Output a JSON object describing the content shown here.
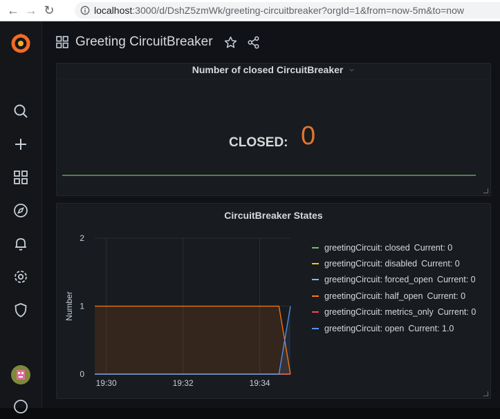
{
  "browser": {
    "url_host": "localhost",
    "url_rest": ":3000/d/DshZ5zmWk/greeting-circuitbreaker?orgId=1&from=now-5m&to=now",
    "back_glyph": "←",
    "forward_glyph": "→",
    "reload_glyph": "↻"
  },
  "dashboard": {
    "title": "Greeting CircuitBreaker"
  },
  "sidebar": {
    "icons": [
      "grafana-logo-icon",
      "search-icon",
      "plus-icon",
      "dashboards-icon",
      "explore-icon",
      "alerting-icon",
      "configuration-icon",
      "shield-icon",
      "user-avatar",
      "help-icon"
    ]
  },
  "stat_panel": {
    "title": "Number of closed CircuitBreaker",
    "label": "CLOSED:",
    "value": "0",
    "value_color": "#e0752d",
    "sparkline_color": "#73bf69"
  },
  "graph_panel": {
    "title": "CircuitBreaker States",
    "ylabel": "Number",
    "yticks": [
      "2",
      "1",
      "0"
    ],
    "xticks": [
      "19:30",
      "19:32",
      "19:34"
    ],
    "legend": [
      {
        "name": "greetingCircuit: closed",
        "current": "Current: 0",
        "color": "#73bf69"
      },
      {
        "name": "greetingCircuit: disabled",
        "current": "Current: 0",
        "color": "#f2cc0c"
      },
      {
        "name": "greetingCircuit: forced_open",
        "current": "Current: 0",
        "color": "#8ab8ff"
      },
      {
        "name": "greetingCircuit: half_open",
        "current": "Current: 0",
        "color": "#ff780a"
      },
      {
        "name": "greetingCircuit: metrics_only",
        "current": "Current: 0",
        "color": "#f2495c"
      },
      {
        "name": "greetingCircuit: open",
        "current": "Current: 1.0",
        "color": "#5794f2"
      }
    ]
  },
  "chart_data": {
    "type": "line",
    "title": "CircuitBreaker States",
    "ylabel": "Number",
    "ylim": [
      0,
      2
    ],
    "x_tick_labels": [
      "19:30",
      "19:32",
      "19:34"
    ],
    "x_range_minutes": [
      "19:29.7",
      "19:34.8"
    ],
    "series": [
      {
        "name": "greetingCircuit: closed",
        "points": [
          [
            "19:29.7",
            0
          ],
          [
            "19:34.8",
            0
          ]
        ]
      },
      {
        "name": "greetingCircuit: disabled",
        "points": [
          [
            "19:29.7",
            0
          ],
          [
            "19:34.8",
            0
          ]
        ]
      },
      {
        "name": "greetingCircuit: forced_open",
        "points": [
          [
            "19:29.7",
            0
          ],
          [
            "19:34.8",
            0
          ]
        ]
      },
      {
        "name": "greetingCircuit: half_open",
        "points": [
          [
            "19:29.7",
            1
          ],
          [
            "19:34.5",
            1
          ],
          [
            "19:34.8",
            0
          ]
        ]
      },
      {
        "name": "greetingCircuit: metrics_only",
        "points": [
          [
            "19:29.7",
            0
          ],
          [
            "19:34.8",
            0
          ]
        ]
      },
      {
        "name": "greetingCircuit: open",
        "points": [
          [
            "19:29.7",
            0
          ],
          [
            "19:34.5",
            0
          ],
          [
            "19:34.8",
            1
          ]
        ]
      }
    ],
    "grid": true,
    "legend_position": "right"
  }
}
